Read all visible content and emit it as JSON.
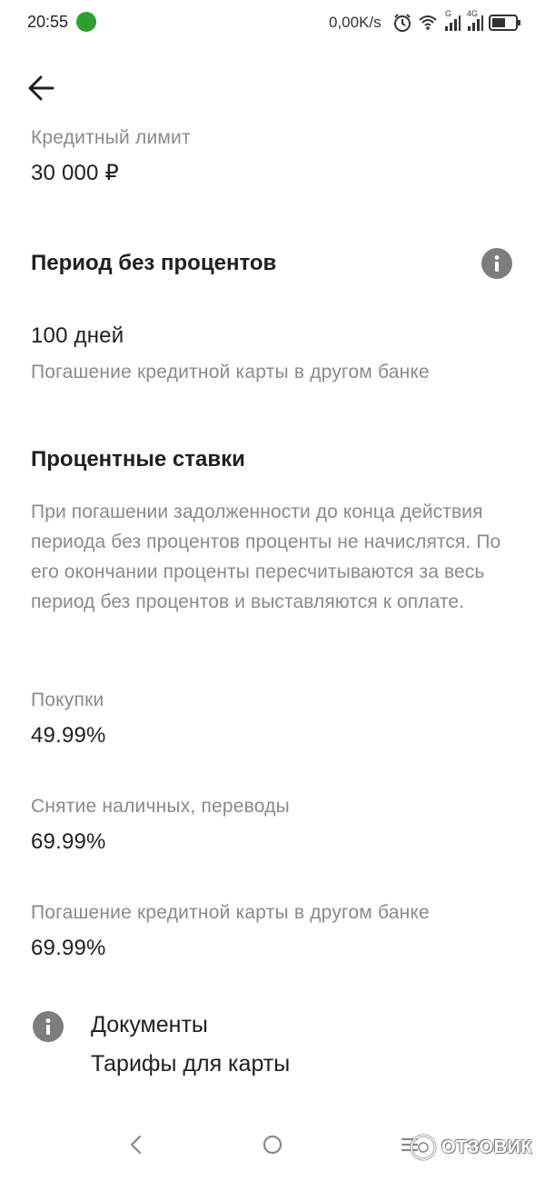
{
  "status_bar": {
    "time": "20:55",
    "network_speed": "0,00K/s",
    "signal1_label": "G",
    "signal2_label": "4G"
  },
  "credit_limit": {
    "label": "Кредитный лимит",
    "value": "30 000 ₽"
  },
  "grace_period": {
    "title": "Период без процентов",
    "value": "100 дней",
    "note": "Погашение кредитной карты в другом банке"
  },
  "interest_rates": {
    "title": "Процентные ставки",
    "description": "При погашении задолженности до конца действия периода без процентов проценты не начислятся. По его окончании проценты пересчитываются за весь период без процентов и выставляются к оплате.",
    "items": [
      {
        "label": "Покупки",
        "value": "49.99%"
      },
      {
        "label": "Снятие наличных, переводы",
        "value": "69.99%"
      },
      {
        "label": "Погашение кредитной карты в другом банке",
        "value": "69.99%"
      }
    ]
  },
  "documents": {
    "title": "Документы",
    "link": "Тарифы для карты"
  },
  "watermark": {
    "text": "ОТЗОВИК"
  },
  "colors": {
    "text_primary": "#1f1f1f",
    "text_secondary": "#8a8a8a",
    "icon_gray": "#7d7d7d"
  },
  "icons": [
    "arrow-left-icon",
    "info-icon",
    "back-nav-icon",
    "home-nav-icon",
    "menu-nav-icon",
    "alarm-icon",
    "wifi-icon",
    "signal-icon",
    "battery-icon"
  ]
}
